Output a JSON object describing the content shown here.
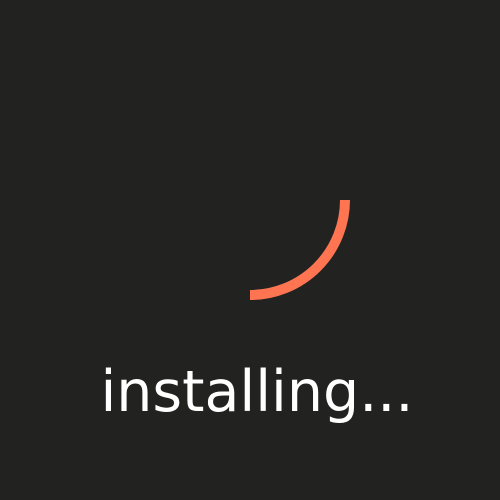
{
  "screen": {
    "status_text": "installing..."
  },
  "spinner": {
    "icon": "loading-spinner-arc",
    "color": "#ff7552"
  },
  "colors": {
    "background": "#222321",
    "text": "#ffffff"
  }
}
